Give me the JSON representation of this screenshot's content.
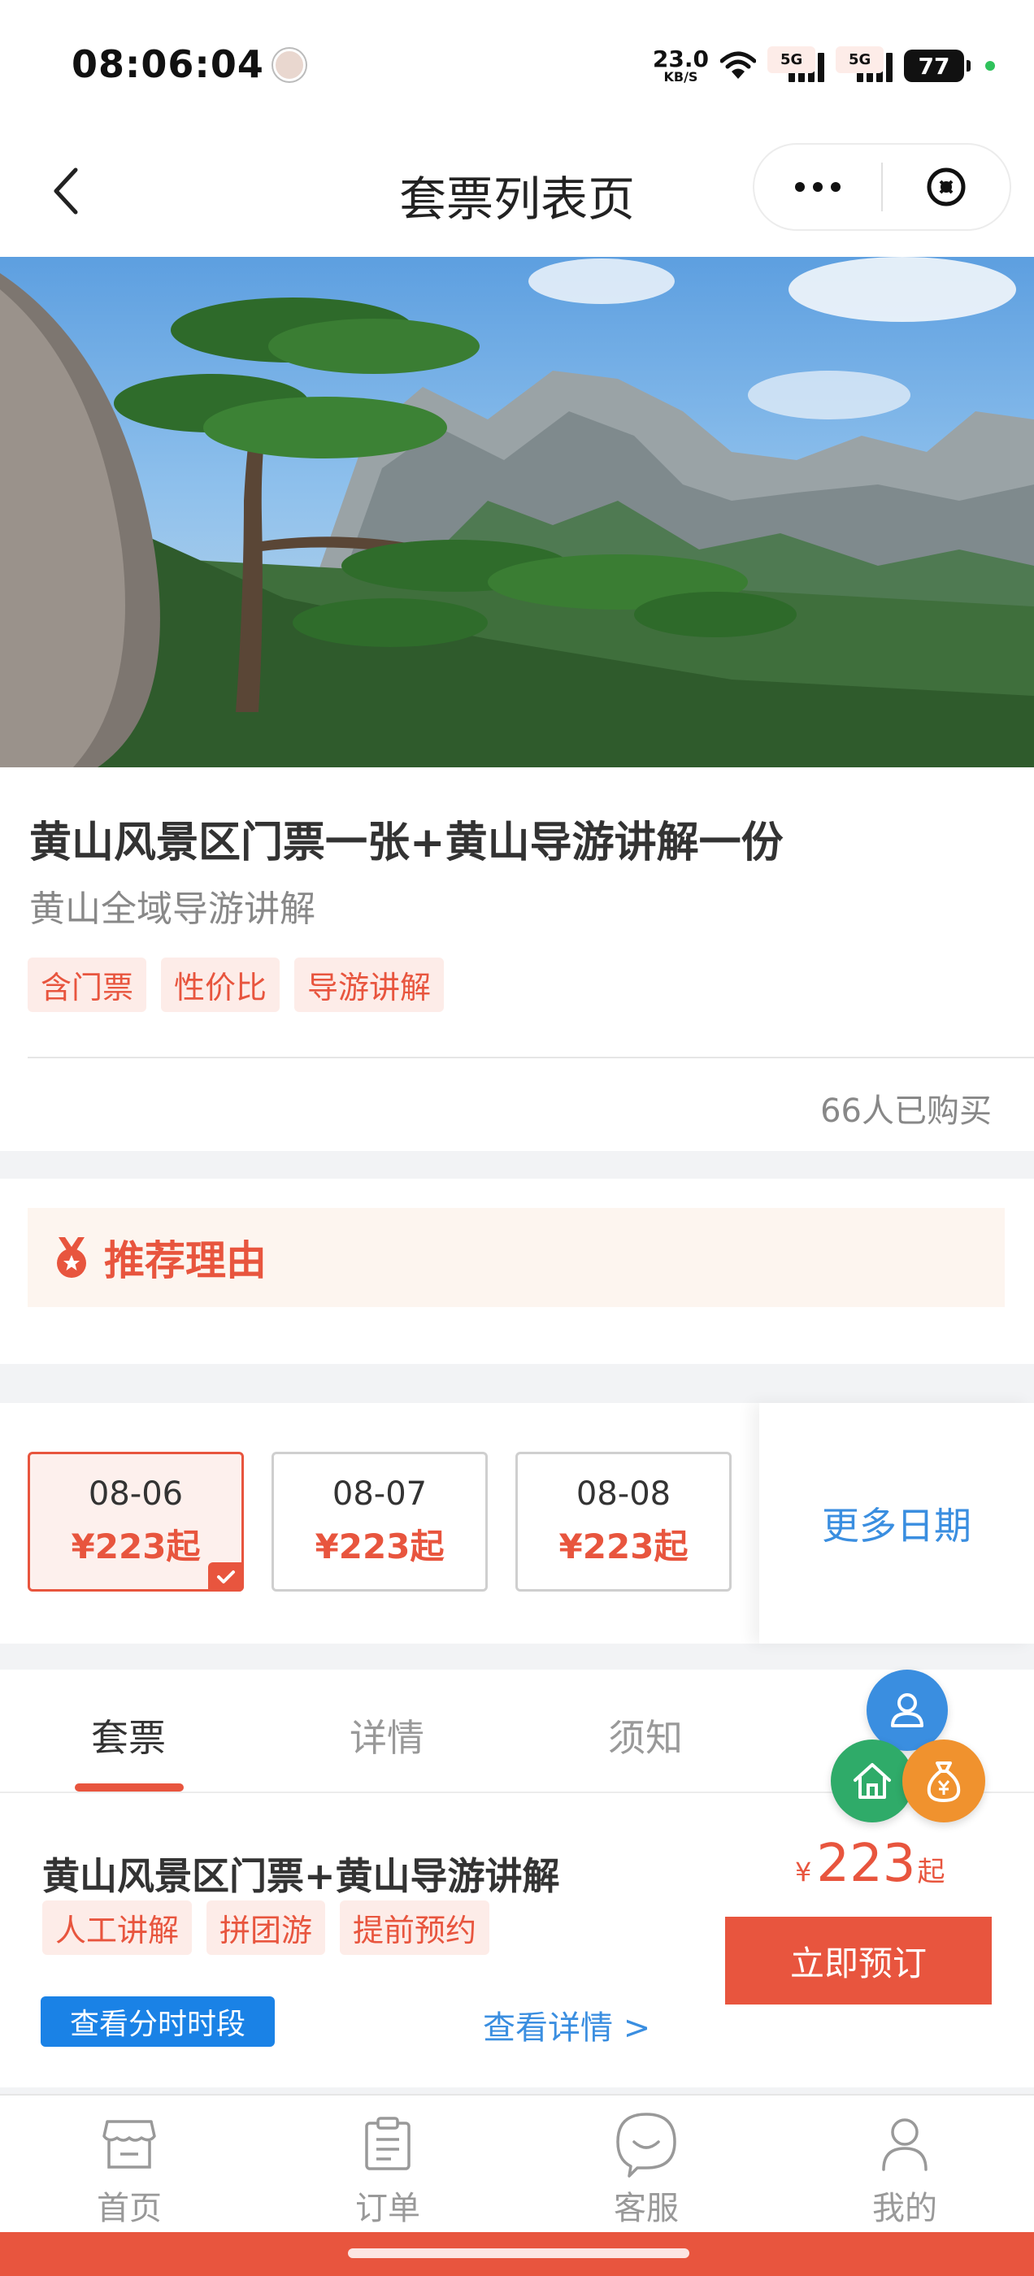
{
  "status_bar": {
    "time": "08:06:04",
    "net_speed_value": "23.0",
    "net_speed_unit": "KB/S",
    "signal_1": "5G",
    "signal_2": "5G",
    "battery": "77"
  },
  "nav": {
    "title": "套票列表页",
    "icons": {
      "back": "chevron-left-icon",
      "more": "more-dots-icon",
      "close": "close-circle-icon"
    }
  },
  "hero": {
    "description": "huangshan-pine-mountain-banner"
  },
  "product_info": {
    "title": "黄山风景区门票一张+黄山导游讲解一份",
    "subtitle": "黄山全域导游讲解",
    "tags": [
      "含门票",
      "性价比",
      "导游讲解"
    ],
    "sold": "66人已购买"
  },
  "recommend": {
    "title": "推荐理由",
    "icon": "medal-icon"
  },
  "dates": {
    "items": [
      {
        "date": "08-06",
        "price": "¥223起",
        "selected": true
      },
      {
        "date": "08-07",
        "price": "¥223起",
        "selected": false
      },
      {
        "date": "08-08",
        "price": "¥223起",
        "selected": false
      }
    ],
    "more_label": "更多日期"
  },
  "tabs": [
    {
      "label": "套票",
      "active": true
    },
    {
      "label": "详情",
      "active": false
    },
    {
      "label": "须知",
      "active": false
    }
  ],
  "package": {
    "title": "黄山风景区门票+黄山导游讲解",
    "tags": [
      "人工讲解",
      "拼团游",
      "提前预约"
    ],
    "price_currency": "¥",
    "price_value": "223",
    "price_suffix": "起",
    "book_label": "立即预订",
    "time_slot_label": "查看分时时段",
    "detail_link": "查看详情 >"
  },
  "floating": {
    "icons": [
      "user-icon",
      "home-icon",
      "money-bag-icon"
    ]
  },
  "bottom_nav": [
    {
      "label": "首页",
      "icon": "store-icon"
    },
    {
      "label": "订单",
      "icon": "order-list-icon"
    },
    {
      "label": "客服",
      "icon": "chat-bubble-icon"
    },
    {
      "label": "我的",
      "icon": "person-icon"
    }
  ],
  "colors": {
    "accent": "#e8553e",
    "link": "#3a8ee0",
    "tag_bg": "#fdece8",
    "time_button": "#1a82e6"
  }
}
